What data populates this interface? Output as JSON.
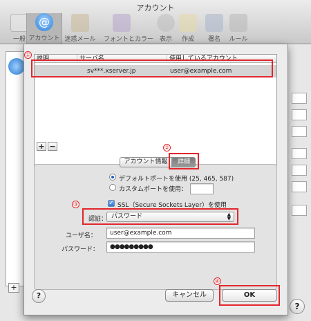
{
  "window": {
    "title": "アカウント"
  },
  "toolbar": {
    "items": [
      {
        "label": "一般",
        "icon": "switch-icon"
      },
      {
        "label": "アカウント",
        "icon": "at-sign-icon"
      },
      {
        "label": "迷惑メール",
        "icon": "junk-mail-icon"
      },
      {
        "label": "フォントとカラー",
        "icon": "font-icon"
      },
      {
        "label": "表示",
        "icon": "glasses-icon"
      },
      {
        "label": "作成",
        "icon": "pencil-icon"
      },
      {
        "label": "署名",
        "icon": "signature-icon"
      },
      {
        "label": "ルール",
        "icon": "rules-icon"
      }
    ],
    "active_index": 1,
    "at_symbol": "@"
  },
  "table": {
    "columns": [
      "説明",
      "サーバ名",
      "使用しているアカウント"
    ],
    "rows": [
      {
        "description": "",
        "server": "sv***.xserver.jp",
        "account": "user@example.com"
      }
    ]
  },
  "list_controls": {
    "add": "+",
    "remove": "−"
  },
  "tabs": {
    "info": "アカウント情報",
    "detail": "詳細",
    "selected": "詳細"
  },
  "port": {
    "default_label": "デフォルトポートを使用 (25, 465, 587)",
    "custom_label": "カスタムポートを使用：",
    "custom_value": "",
    "selected": "default"
  },
  "ssl": {
    "label": "SSL（Secure Sockets Layer）を使用",
    "checked": true,
    "mark": "✓"
  },
  "auth": {
    "label": "認証：",
    "value": "パスワード",
    "arrows": "▲▼"
  },
  "username": {
    "label": "ユーザ名：",
    "value": "user@example.com"
  },
  "password": {
    "label": "パスワード：",
    "value": "●●●●●●●●●"
  },
  "buttons": {
    "cancel": "キャンセル",
    "ok": "OK",
    "help": "?"
  },
  "background_window": {
    "add": "+",
    "help": "?"
  },
  "annotations": {
    "marker_1": "①",
    "marker_2": "②",
    "marker_3": "③",
    "marker_4": "④",
    "color": "#e2262c"
  }
}
